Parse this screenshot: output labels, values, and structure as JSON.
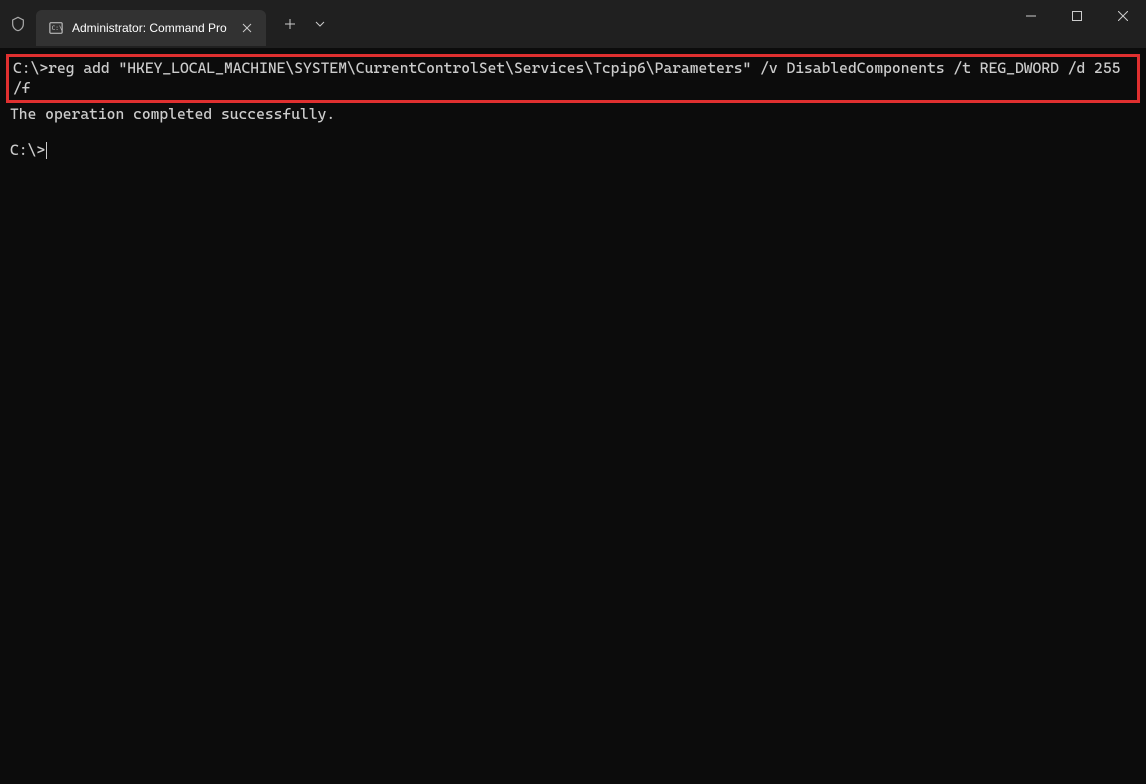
{
  "tab": {
    "title": "Administrator: Command Pro"
  },
  "terminal": {
    "prompt1": "C:\\>",
    "command": "reg add \"HKEY_LOCAL_MACHINE\\SYSTEM\\CurrentControlSet\\Services\\Tcpip6\\Parameters\" /v DisabledComponents /t REG_DWORD /d 255 /f",
    "output": "The operation completed successfully.",
    "prompt2": "C:\\>"
  }
}
